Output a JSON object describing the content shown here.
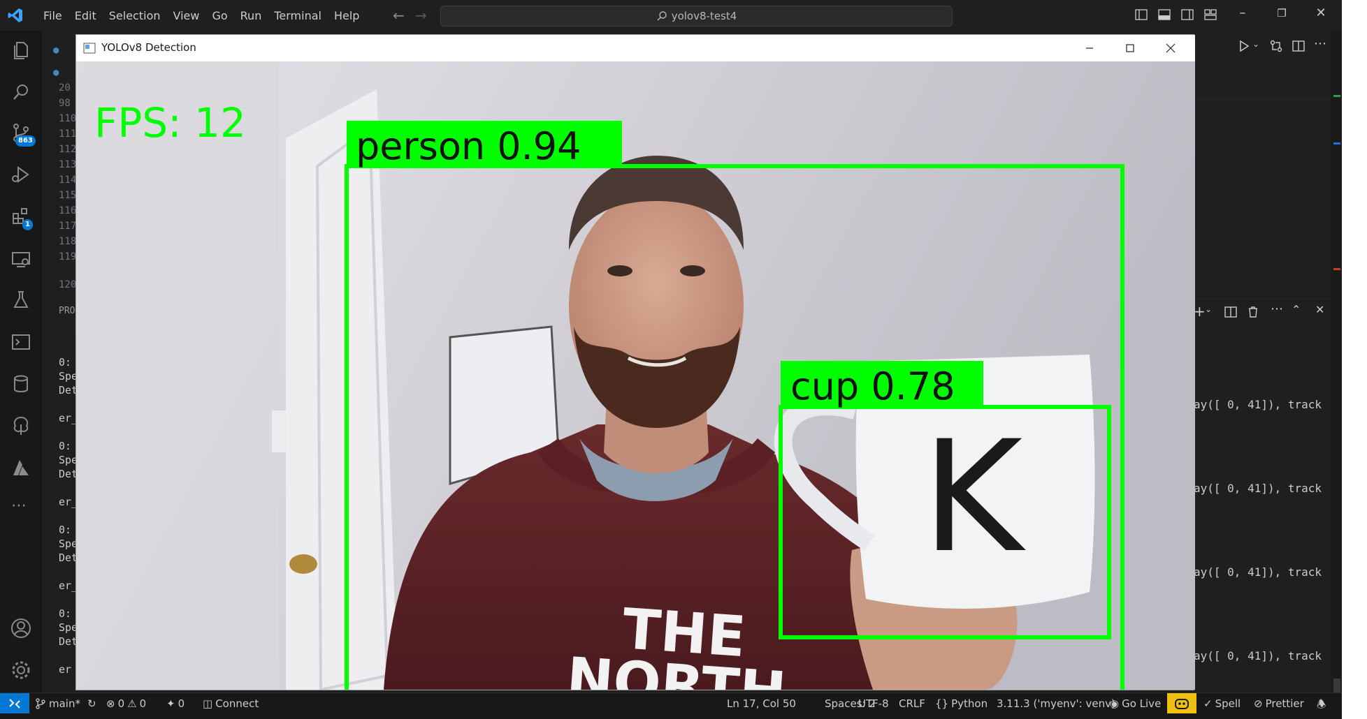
{
  "titlebar": {
    "menu": [
      "File",
      "Edit",
      "Selection",
      "View",
      "Go",
      "Run",
      "Terminal",
      "Help"
    ],
    "command_center": "yolov8-test4"
  },
  "activitybar": {
    "icons": [
      "files-icon",
      "search-icon",
      "source-control-icon",
      "run-debug-icon",
      "extensions-icon",
      "remote-explorer-icon",
      "testing-icon",
      "terminal-icon",
      "database-icon",
      "tree-icon",
      "azure-icon",
      "more-icon",
      "account-icon",
      "settings-gear-icon"
    ],
    "source_control_badge": "863",
    "extensions_badge": "1"
  },
  "editor": {
    "line_numbers": [
      "20",
      "98",
      "110",
      "111",
      "112",
      "113",
      "114",
      "115",
      "116",
      "117",
      "118",
      "119",
      "120"
    ],
    "panel_label": "PRO",
    "terminal_lines": [
      "0:",
      "Spe",
      "Det",
      "er_",
      "0:",
      "Spe",
      "Det",
      "er_",
      "0:",
      "Spe",
      "Det",
      "er_",
      "0:",
      "Spe",
      "Det",
      "er"
    ],
    "right_terminal_text": "ay([ 0, 41]), track"
  },
  "cv_window": {
    "title": "YOLOv8 Detection",
    "fps_text": "FPS: 12",
    "detections": [
      {
        "label": "person",
        "confidence": "0.94"
      },
      {
        "label": "cup",
        "confidence": "0.78"
      }
    ],
    "accent": "#00ff00"
  },
  "statusbar": {
    "branch": "main*",
    "errors": "0",
    "warnings": "0",
    "ports": "0",
    "connect": "Connect",
    "position": "Ln 17, Col 50",
    "spaces": "Spaces: 2",
    "encoding": "UTF-8",
    "eol": "CRLF",
    "language": "Python",
    "interpreter": "3.11.3 ('myenv': venv)",
    "go_live": "Go Live",
    "spell": "Spell",
    "prettier": "Prettier"
  }
}
